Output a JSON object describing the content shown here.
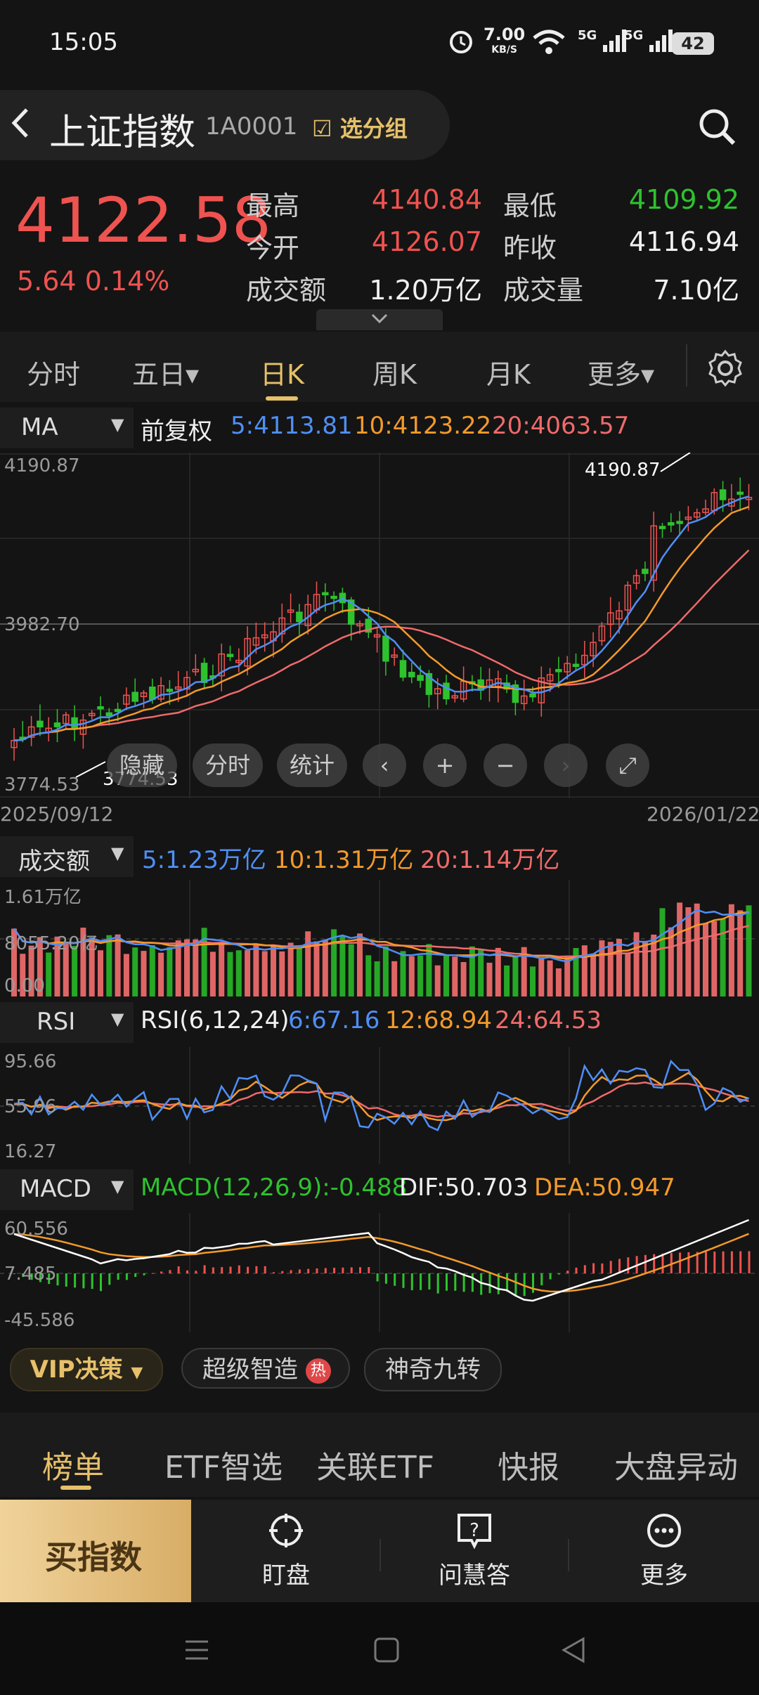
{
  "status": {
    "time": "15:05",
    "net_speed": "7.00",
    "net_unit": "KB/S",
    "sig1": "5G",
    "sig2": "5G",
    "battery": "42"
  },
  "header": {
    "back": "<",
    "title": "上证指数",
    "code": "1A0001",
    "group_label": "选分组"
  },
  "quote": {
    "price": "4122.58",
    "change": "5.64 0.14%",
    "high_label": "最高",
    "high": "4140.84",
    "low_label": "最低",
    "low": "4109.92",
    "open_label": "今开",
    "open": "4126.07",
    "prev_label": "昨收",
    "prev": "4116.94",
    "amount_label": "成交额",
    "amount": "1.20万亿",
    "volume_label": "成交量",
    "volume": "7.10亿"
  },
  "tabs": [
    {
      "label": "分时"
    },
    {
      "label": "五日▾"
    },
    {
      "label": "日K"
    },
    {
      "label": "周K"
    },
    {
      "label": "月K"
    },
    {
      "label": "更多▾"
    }
  ],
  "kline": {
    "indicator": "MA",
    "adjust": "前复权",
    "ma5": "5:4113.81",
    "ma10": "10:4123.22",
    "ma20": "20:4063.57",
    "y_top": "4190.87",
    "y_mid": "3982.70",
    "y_bot": "3774.53",
    "max_label": "4190.87",
    "min_label": "3774.53",
    "date_start": "2025/09/12",
    "date_end": "2026/01/22",
    "buttons": {
      "hide": "隐藏",
      "intraday": "分时",
      "stats": "统计"
    }
  },
  "volume": {
    "indicator": "成交额",
    "ma5": "5:1.23万亿",
    "ma10": "10:1.31万亿",
    "ma20": "20:1.14万亿",
    "y_top": "1.61万亿",
    "y_mid": "8055.20亿",
    "y_bot": "0.00"
  },
  "rsi": {
    "indicator": "RSI",
    "params": "RSI(6,12,24)",
    "r6": "6:67.16",
    "r12": "12:68.94",
    "r24": "24:64.53",
    "y_top": "95.66",
    "y_mid": "55.96",
    "y_bot": "16.27"
  },
  "macd": {
    "indicator": "MACD",
    "params": "MACD(12,26,9):-0.488",
    "dif": "DIF:50.703",
    "dea": "DEA:50.947",
    "y_top": "60.556",
    "y_mid": "7.485",
    "y_bot": "-45.586"
  },
  "chips": {
    "vip": "VIP决策",
    "chip2": "超级智造",
    "hot": "热",
    "chip3": "神奇九转"
  },
  "sections": [
    {
      "label": "榜单"
    },
    {
      "label": "ETF智选"
    },
    {
      "label": "关联ETF"
    },
    {
      "label": "快报"
    },
    {
      "label": "大盘异动"
    }
  ],
  "actions": {
    "buy": "买指数",
    "watch": "盯盘",
    "qa": "问慧答",
    "more": "更多"
  },
  "colors": {
    "up": "#ef5350",
    "down": "#2ec22e",
    "gold": "#e6c06a",
    "ma5": "#4f8ff7",
    "ma10": "#f39a2b",
    "ma20": "#f06a6a"
  }
}
